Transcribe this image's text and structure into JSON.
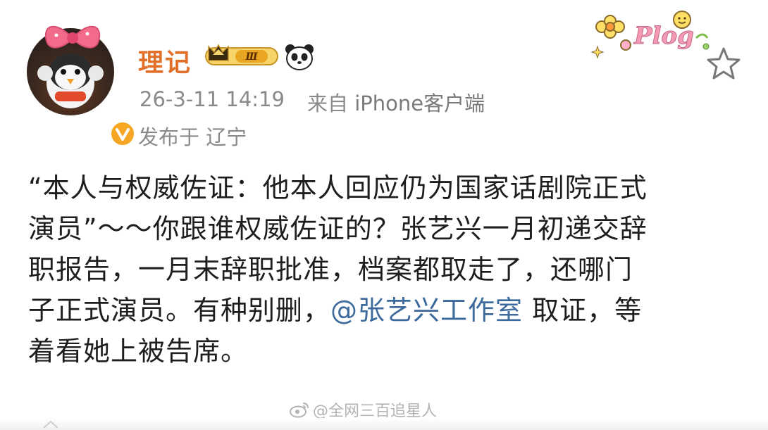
{
  "user": {
    "name": "理记",
    "vip_level": "Ⅲ",
    "verified": true
  },
  "meta": {
    "time": "26-3-11 14:19",
    "source_prefix": "来自",
    "source_app": "iPhone客户端",
    "location": "发布于 辽宁"
  },
  "sticker": {
    "text": "Plog"
  },
  "post": {
    "lines": [
      "“本人与权威佐证：他本人回应仍为国家话剧院正式",
      "演员”～～你跟谁权威佐证的？张艺兴一月初递交辞",
      "职报告，一月末辞职批准，档案都取走了，还哪门",
      "子正式演员。有种别删，",
      "着看她上被告席。"
    ],
    "mention": "@张艺兴工作室",
    "after_mention": " 取证，等"
  },
  "watermark": {
    "text": "@全网三百追星人"
  },
  "colors": {
    "name": "#e0702a",
    "meta": "#8a8a8a",
    "body": "#1e1e1e",
    "mention": "#3c6a9c",
    "verify_badge": "#f5a623"
  }
}
